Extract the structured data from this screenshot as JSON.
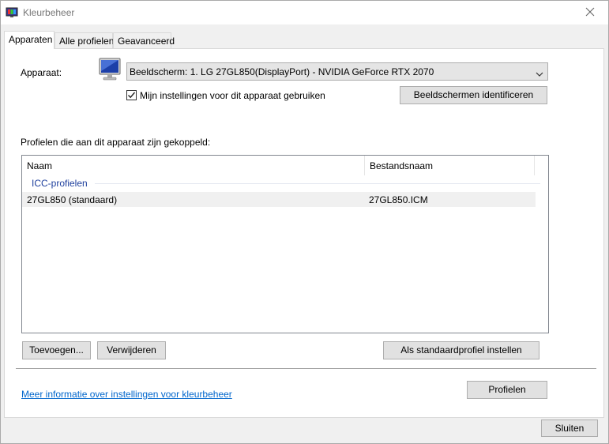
{
  "window": {
    "title": "Kleurbeheer"
  },
  "tabs": [
    {
      "label": "Apparaten",
      "active": true
    },
    {
      "label": "Alle profielen",
      "active": false
    },
    {
      "label": "Geavanceerd",
      "active": false
    }
  ],
  "device": {
    "label": "Apparaat:",
    "selected": "Beeldscherm: 1. LG 27GL850(DisplayPort) - NVIDIA GeForce RTX 2070",
    "checkbox_label": "Mijn instellingen voor dit apparaat gebruiken",
    "checkbox_checked": true,
    "identify_button": "Beeldschermen identificeren"
  },
  "profiles": {
    "label": "Profielen die aan dit apparaat zijn gekoppeld:",
    "columns": [
      "Naam",
      "Bestandsnaam"
    ],
    "group": "ICC-profielen",
    "rows": [
      {
        "name": "27GL850 (standaard)",
        "file": "27GL850.ICM"
      }
    ]
  },
  "buttons": {
    "add": "Toevoegen...",
    "remove": "Verwijderen",
    "set_default": "Als standaardprofiel instellen",
    "profiles": "Profielen",
    "close": "Sluiten"
  },
  "link": {
    "more_info": "Meer informatie over instellingen voor kleurbeheer"
  },
  "icons": {
    "app": "color-management-icon",
    "close": "close-icon",
    "monitor": "monitor-icon",
    "dropdown": "chevron-down-icon",
    "check": "checkmark-icon"
  }
}
